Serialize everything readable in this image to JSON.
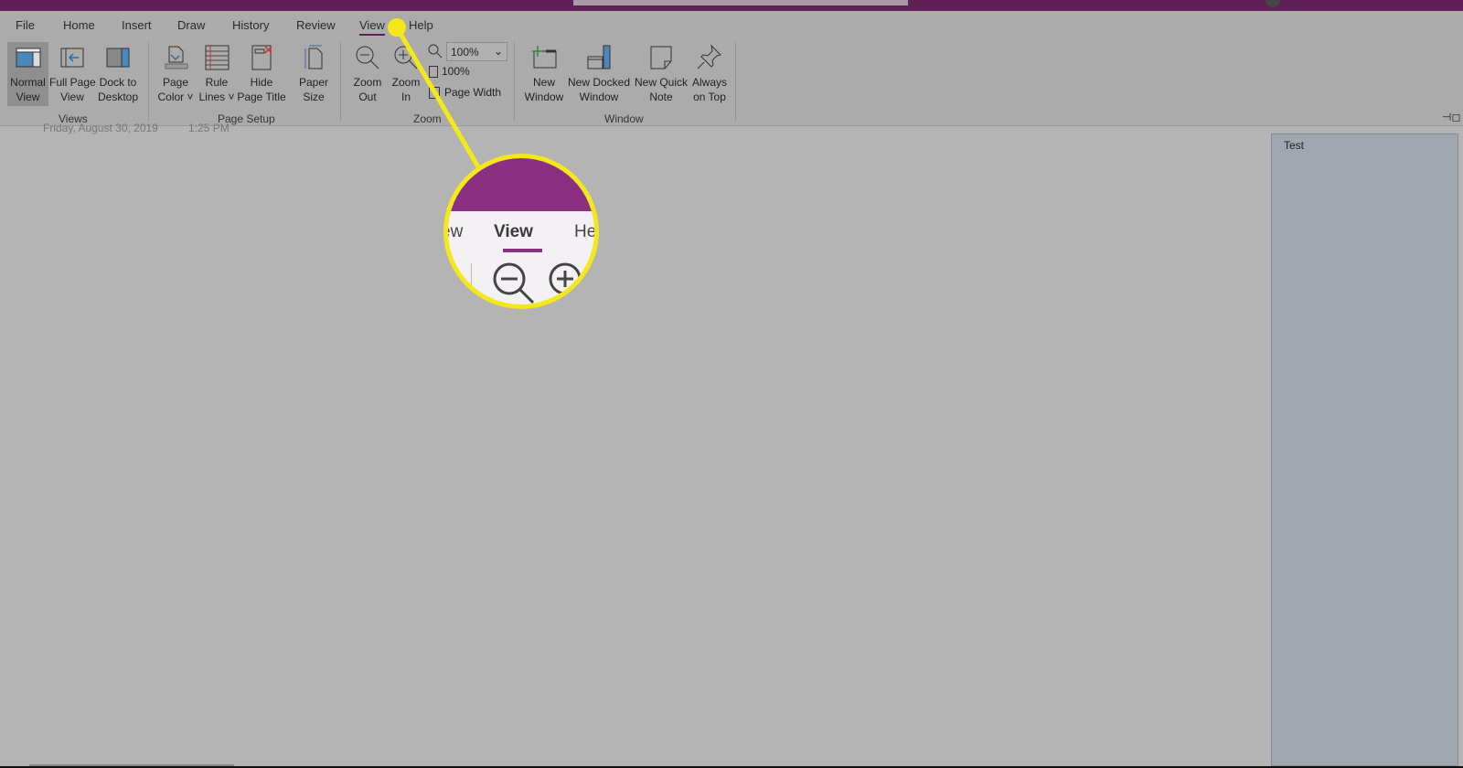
{
  "colors": {
    "title_bar": "#5e2057",
    "accent": "#8a2f82",
    "highlight": "#f4e81a"
  },
  "tabs": [
    {
      "label": "File"
    },
    {
      "label": "Home"
    },
    {
      "label": "Insert"
    },
    {
      "label": "Draw"
    },
    {
      "label": "History"
    },
    {
      "label": "Review"
    },
    {
      "label": "View",
      "active": true
    },
    {
      "label": "Help"
    }
  ],
  "ribbon": {
    "views": {
      "label": "Views",
      "normal_view": "Normal\nView",
      "full_page_view": "Full Page\nView",
      "dock_to_desktop": "Dock to\nDesktop"
    },
    "page_setup": {
      "label": "Page Setup",
      "page_color": "Page\nColor ˅",
      "rule_lines": "Rule\nLines ˅",
      "hide_page_title": "Hide\nPage Title",
      "paper_size": "Paper\nSize"
    },
    "zoom": {
      "label": "Zoom",
      "zoom_out": "Zoom\nOut",
      "zoom_in": "Zoom\nIn",
      "zoom_value": "100%",
      "hundred_percent": "100%",
      "page_width": "Page Width"
    },
    "window": {
      "label": "Window",
      "new_window": "New\nWindow",
      "new_docked_window": "New Docked\nWindow",
      "new_quick_note": "New Quick\nNote",
      "always_on_top": "Always\non Top"
    }
  },
  "page": {
    "date": "Friday, August 30, 2019",
    "time": "1:25 PM"
  },
  "pages_pane": {
    "items": [
      {
        "title": "Test"
      }
    ]
  },
  "magnifier": {
    "tabs": [
      "ew",
      "View",
      "He"
    ]
  }
}
